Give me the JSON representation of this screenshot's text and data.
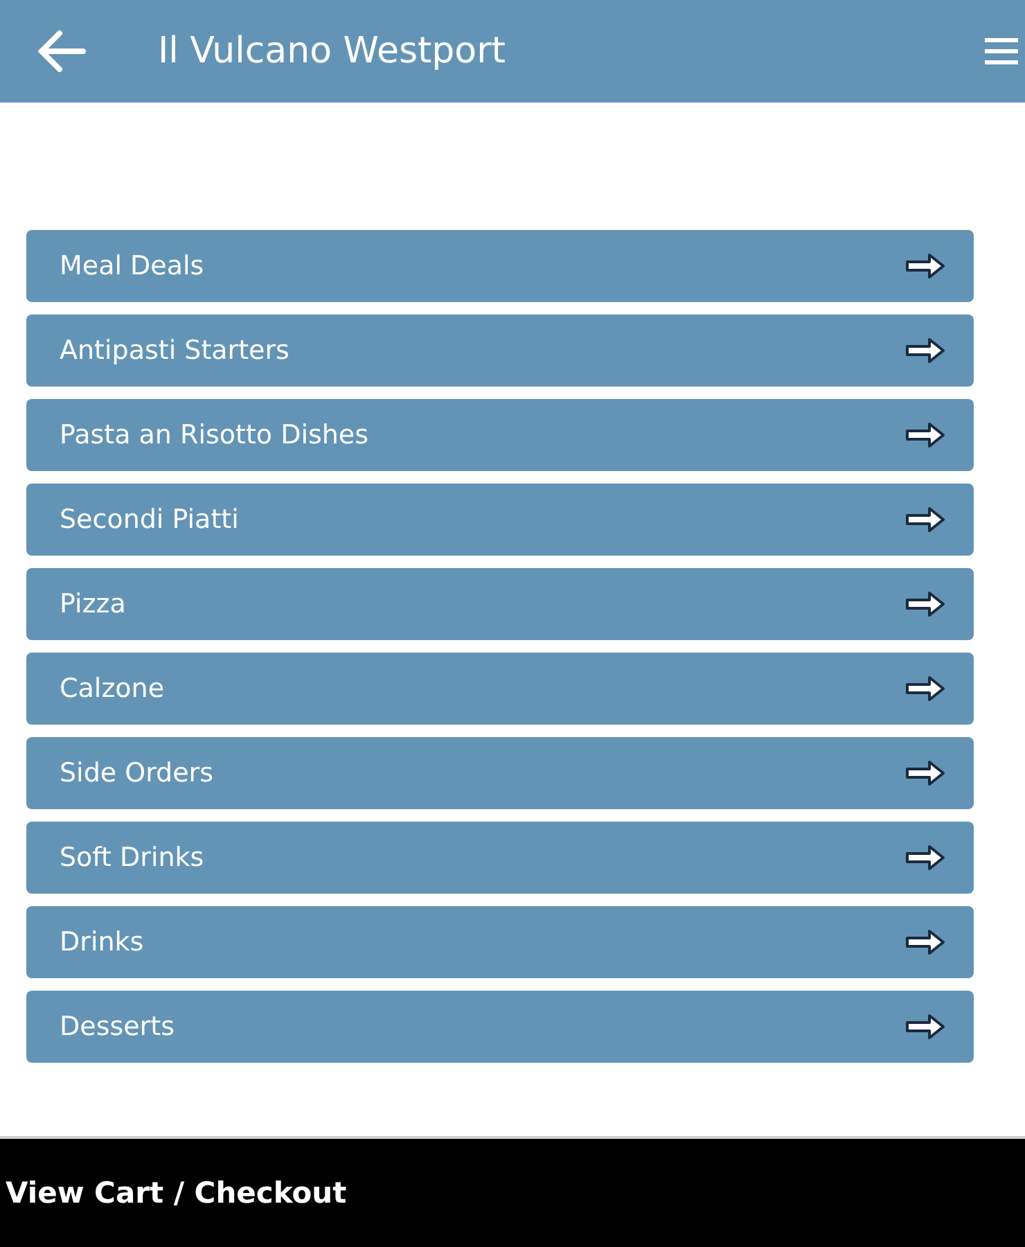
{
  "header": {
    "title": "Il Vulcano Westport"
  },
  "menu_categories": [
    {
      "label": "Meal Deals"
    },
    {
      "label": "Antipasti Starters"
    },
    {
      "label": "Pasta an Risotto Dishes"
    },
    {
      "label": "Secondi Piatti"
    },
    {
      "label": "Pizza"
    },
    {
      "label": "Calzone"
    },
    {
      "label": "Side Orders"
    },
    {
      "label": "Soft Drinks"
    },
    {
      "label": "Drinks"
    },
    {
      "label": "Desserts"
    }
  ],
  "footer": {
    "cart_button": "View Cart / Checkout"
  }
}
